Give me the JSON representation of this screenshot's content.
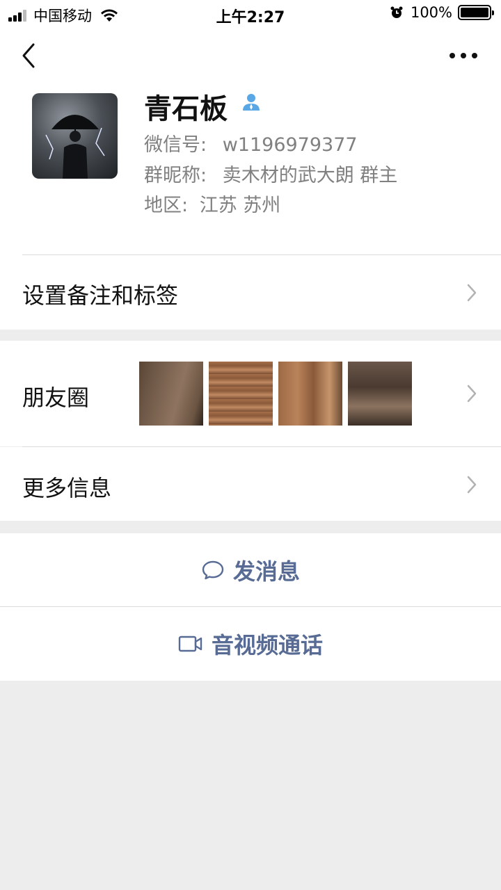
{
  "status_bar": {
    "carrier": "中国移动",
    "time": "上午2:27",
    "battery": "100%"
  },
  "profile": {
    "name": "青石板",
    "wechat_id_label": "微信号:",
    "wechat_id": "w1196979377",
    "group_nick_label": "群昵称:",
    "group_nick": "卖木材的武大朗 群主",
    "region_label": "地区:",
    "region": "江苏 苏州"
  },
  "cells": {
    "remark": "设置备注和标签",
    "moments": "朋友圈",
    "more_info": "更多信息"
  },
  "actions": {
    "message": "发消息",
    "call": "音视频通话"
  },
  "colors": {
    "link": "#576b95",
    "background": "#ededed"
  }
}
